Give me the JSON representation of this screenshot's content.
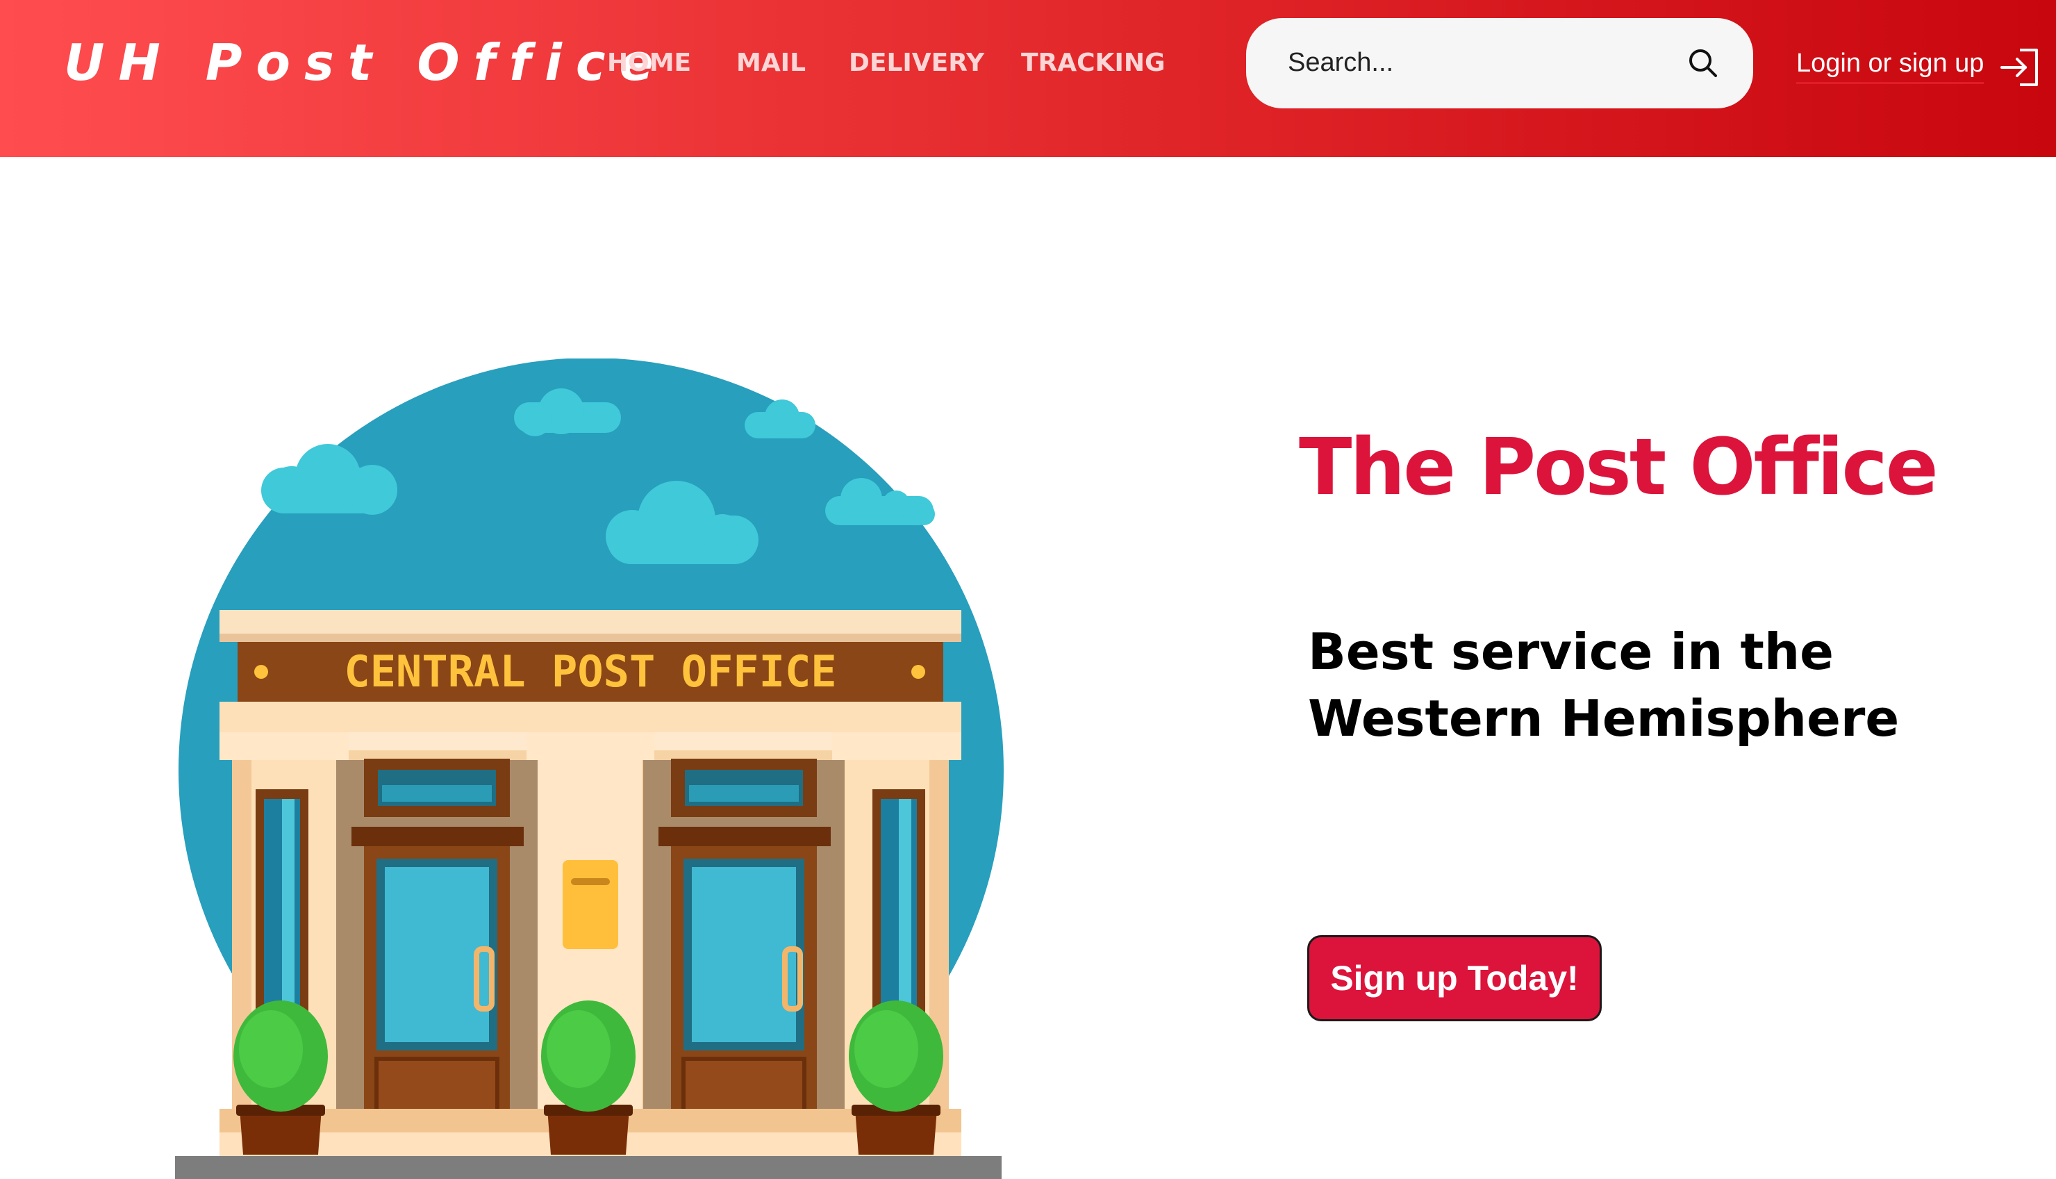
{
  "header": {
    "brand": "UH Post Office",
    "nav": [
      "HOME",
      "MAIL",
      "DELIVERY",
      "TRACKING"
    ],
    "search": {
      "placeholder": "Search...",
      "icon": "search-icon"
    },
    "login": {
      "label": "Login or sign up",
      "icon": "login-arrow-icon"
    }
  },
  "hero": {
    "title": "The Post Office",
    "subtitle": "Best service in the Western Hemisphere",
    "cta_label": "Sign up Today!"
  },
  "illustration": {
    "sign_text": "CENTRAL POST OFFICE"
  },
  "colors": {
    "header_gradient_start": "#ff4d4f",
    "header_gradient_end": "#c8060e",
    "accent": "#dc143c",
    "sky": "#279fbd",
    "cloud": "#3fc9d9",
    "sign_text": "#ffc23d"
  }
}
